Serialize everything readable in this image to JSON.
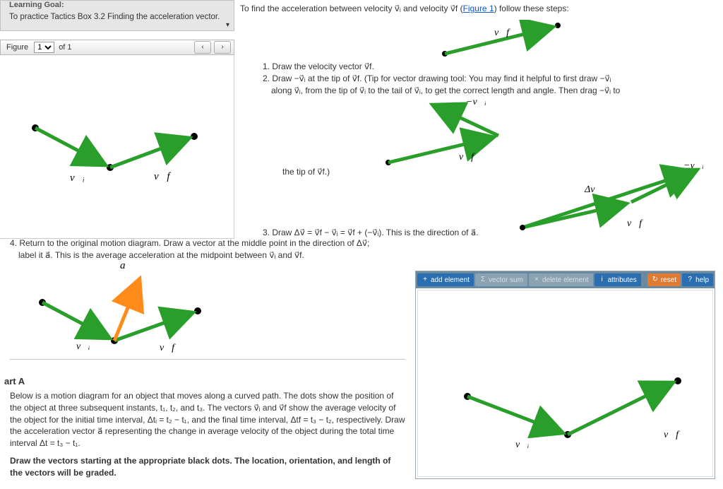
{
  "learning_goal": {
    "header": "Learning Goal:",
    "text": "To practice Tactics Box 3.2 Finding the acceleration vector."
  },
  "figure_nav": {
    "label": "Figure",
    "selected": "1",
    "of": "of 1",
    "prev": "‹",
    "next": "›"
  },
  "intro": {
    "pre": "To find the acceleration between velocity v⃗ᵢ and velocity v⃗f (",
    "link": "Figure 1",
    "post": ") follow these steps:"
  },
  "steps": {
    "s1": "1. Draw the velocity vector v⃗f.",
    "s2a": "2. Draw −v⃗ᵢ at the tip of v⃗f. (Tip for vector drawing tool: You may find it helpful to first draw −v⃗ᵢ",
    "s2b": "along v⃗ᵢ, from the tip of v⃗ᵢ to the tail of v⃗ᵢ, to get the correct length and angle. Then drag −v⃗ᵢ to",
    "s2c": "the tip of v⃗f.)",
    "s3": "3. Draw Δv⃗ = v⃗f − v⃗ᵢ = v⃗f + (−v⃗ᵢ). This is the direction of a⃗.",
    "s4a": "4. Return to the original motion diagram. Draw a vector at the middle point in the direction of Δv⃗;",
    "s4b": "label it a⃗. This is the average acceleration at the midpoint between v⃗ᵢ and v⃗f."
  },
  "labels": {
    "vi": "v⃗ᵢ",
    "vf": "v⃗f",
    "nvi": "−v⃗ᵢ",
    "dv": "Δv⃗",
    "a": "a⃗"
  },
  "parta": {
    "title": "art A",
    "body": "Below is a motion diagram for an object that moves along a curved path. The dots show the position of the object at three subsequent instants, t₁, t₂, and t₃. The vectors v⃗ᵢ and v⃗f show the average velocity of the object for the initial time interval, Δtᵢ = t₂ − t₁, and the final time interval, Δtf = t₃ − t₂, respectively. Draw the acceleration vector a⃗ representing the change in average velocity of the object during the total time interval Δt = t₃ − t₁.",
    "bold": "Draw the vectors starting at the appropriate black dots. The location, orientation, and length of the vectors will be graded."
  },
  "toolbar": {
    "add": "add element",
    "sum": "vector sum",
    "del": "delete element",
    "attr": "attributes",
    "reset": "reset",
    "help": "help"
  },
  "chart_data": [
    {
      "type": "diagram",
      "name": "figure1-vectors",
      "points": {
        "A": [
          50,
          183
        ],
        "B": [
          156,
          239
        ],
        "C": [
          275,
          195
        ]
      },
      "vectors": [
        {
          "from": "A",
          "to": "B",
          "label": "vi"
        },
        {
          "from": "B",
          "to": "C",
          "label": "vf"
        }
      ]
    },
    {
      "type": "diagram",
      "name": "step1-vf",
      "vector": {
        "from": [
          0,
          38
        ],
        "to": [
          130,
          0
        ],
        "label": "vf"
      }
    },
    {
      "type": "diagram",
      "name": "step2-vfminusvi",
      "vf": {
        "from": [
          0,
          55
        ],
        "to": [
          128,
          18
        ]
      },
      "neg_vi": {
        "from": [
          128,
          18
        ],
        "to": [
          30,
          -28
        ]
      }
    },
    {
      "type": "diagram",
      "name": "step3-triangle",
      "vf": {
        "from": [
          0,
          70
        ],
        "to": [
          128,
          33
        ]
      },
      "neg_vi": {
        "from": [
          128,
          33
        ],
        "to": [
          210,
          -12
        ]
      },
      "dv": {
        "from": [
          0,
          70
        ],
        "to": [
          210,
          -12
        ]
      }
    },
    {
      "type": "diagram",
      "name": "step4-accel",
      "points": {
        "A": [
          38,
          44
        ],
        "B": [
          140,
          98
        ],
        "C": [
          258,
          56
        ]
      },
      "vectors": [
        {
          "from": "A",
          "to": "B",
          "label": "vi"
        },
        {
          "from": "B",
          "to": "C",
          "label": "vf"
        }
      ],
      "accel": {
        "from": [
          140,
          98
        ],
        "to": [
          178,
          14
        ],
        "label": "a"
      }
    },
    {
      "type": "diagram",
      "name": "drawing-canvas",
      "points": {
        "A": [
          52,
          163
        ],
        "B": [
          192,
          215
        ],
        "C": [
          348,
          140
        ]
      },
      "vectors": [
        {
          "from": "A",
          "to": "B",
          "label": "vi"
        },
        {
          "from": "B",
          "to": "C",
          "label": "vf"
        }
      ]
    }
  ]
}
